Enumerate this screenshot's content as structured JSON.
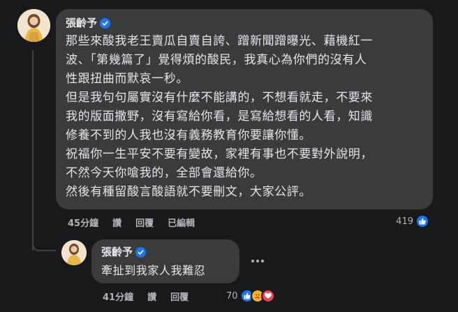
{
  "colors": {
    "background": "#18191a",
    "bubble": "#3a3b3c",
    "text": "#e4e6eb",
    "meta": "#b0b3b8",
    "verified": "#1877f2",
    "like": "#1877f2",
    "love": "#f33e58",
    "care": "#f7b125"
  },
  "main_comment": {
    "author": "張齡予",
    "verified_icon": "verified-badge-icon",
    "lines": [
      "那些來酸我老王賣瓜自賣自誇、蹭新聞蹭曝光、藉機紅一",
      "波、「第幾篇了」覺得煩的酸民，我真心為你們的沒有人",
      "性跟扭曲而默哀一秒。",
      "但是我句句屬實沒有什麼不能講的，不想看就走，不要來",
      "我的版面撒野，沒有寫給你看，是寫給想看的人看，知識",
      "修養不到的人我也沒有義務教育你要讓你懂。",
      "祝福你一生平安不要有變故，家裡有事也不要對外說明，",
      "不然今天你嗆我的，全部會還給你。",
      "然後有種留酸言酸語就不要刪文，大家公評。"
    ],
    "time": "45分鐘",
    "like_label": "讚",
    "reply_label": "回覆",
    "edited_label": "已編輯",
    "reaction_count": "419",
    "reaction_icons": [
      "like-icon"
    ]
  },
  "reply_comment": {
    "author": "張齡予",
    "verified_icon": "verified-badge-icon",
    "text": "牽扯到我家人我難忍",
    "time": "41分鐘",
    "like_label": "讚",
    "reply_label": "回覆",
    "reaction_count": "70",
    "reaction_icons": [
      "like-icon",
      "care-icon",
      "love-icon"
    ]
  }
}
